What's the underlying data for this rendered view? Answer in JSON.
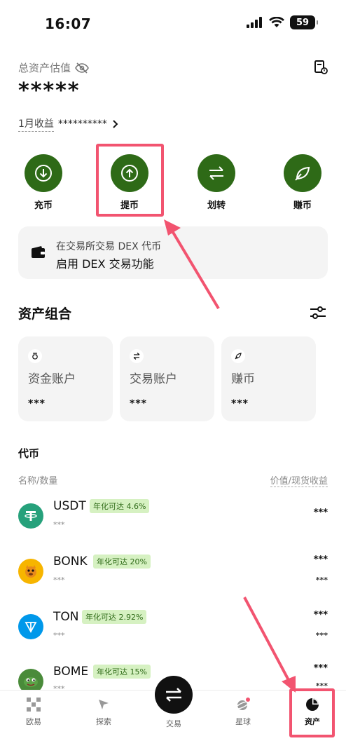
{
  "status": {
    "time": "16:07",
    "battery": "59"
  },
  "header": {
    "asset_label": "总资产估值",
    "asset_value": "*****",
    "monthly_label": "1月收益",
    "monthly_value": "**********"
  },
  "actions": [
    {
      "label": "充币",
      "icon": "deposit-icon"
    },
    {
      "label": "提币",
      "icon": "withdraw-icon"
    },
    {
      "label": "划转",
      "icon": "transfer-icon"
    },
    {
      "label": "赚币",
      "icon": "earn-icon"
    }
  ],
  "dex": {
    "line1": "在交易所交易 DEX 代币",
    "line2": "启用 DEX 交易功能"
  },
  "portfolio": {
    "title": "资产组合",
    "accounts": [
      {
        "name": "资金账户",
        "value": "***"
      },
      {
        "name": "交易账户",
        "value": "***"
      },
      {
        "name": "赚币",
        "value": "***"
      }
    ]
  },
  "tokens": {
    "title": "代币",
    "col_left": "名称/数量",
    "col_right": "价值/现货收益",
    "items": [
      {
        "symbol": "USDT",
        "badge": "年化可达 4.6%",
        "sub": "***",
        "value": "***",
        "value2": "",
        "color": "#26a17b"
      },
      {
        "symbol": "BONK",
        "badge": "年化可达 20%",
        "sub": "***",
        "value": "***",
        "value2": "***",
        "color": "#f7b500"
      },
      {
        "symbol": "TON",
        "badge": "年化可达 2.92%",
        "sub": "***",
        "value": "***",
        "value2": "***",
        "color": "#0098ea"
      },
      {
        "symbol": "BOME",
        "badge": "年化可达 15%",
        "sub": "***",
        "value": "***",
        "value2": "***",
        "color": "#4a8b3a"
      }
    ]
  },
  "tabbar": {
    "tabs": [
      {
        "label": "欧易"
      },
      {
        "label": "探索"
      },
      {
        "label": "交易"
      },
      {
        "label": "星球"
      },
      {
        "label": "资产"
      }
    ]
  },
  "colors": {
    "accent": "#2e6a17",
    "highlight": "#f25470",
    "badge_bg": "#d6f1c2"
  }
}
